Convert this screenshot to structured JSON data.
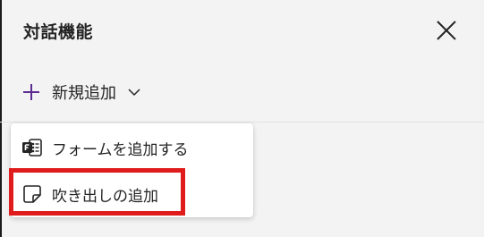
{
  "panel": {
    "title": "対話機能",
    "close_icon": "close-icon"
  },
  "add_new": {
    "label": "新規追加",
    "plus_icon": "plus-icon",
    "chevron_icon": "chevron-down-icon",
    "accent_color": "#5b2d90"
  },
  "menu": {
    "items": [
      {
        "label": "フォームを追加する",
        "icon": "forms-icon"
      },
      {
        "label": "吹き出しの追加",
        "icon": "callout-icon"
      }
    ]
  },
  "highlight": {
    "color": "#e01b1b"
  }
}
